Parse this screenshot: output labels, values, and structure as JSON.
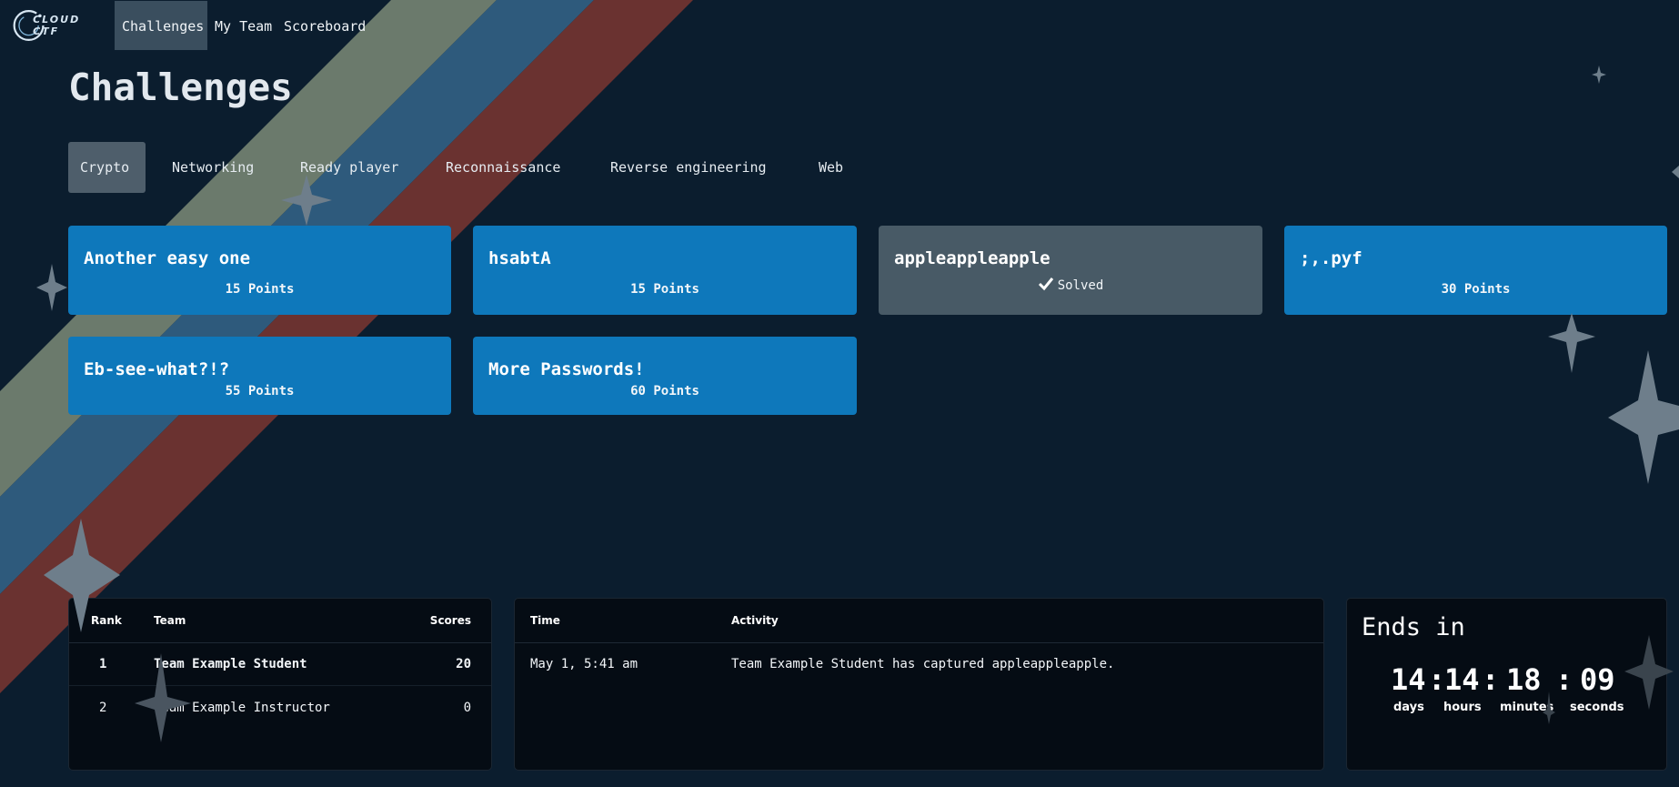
{
  "colors": {
    "background": "#0b1d2e",
    "stripe_sage": "#6b7a6c",
    "stripe_blue": "#2e5a7c",
    "stripe_red": "#6a3230",
    "card_blue": "#0e78bb",
    "card_solved": "#485a66",
    "nav_active": "#3a4e5e",
    "tab_active": "#4e5e6b",
    "panel_bg": "#050c14",
    "sparkle": "#6e7e8b"
  },
  "brand": {
    "name": "CLOUD CTF",
    "logo_icon": "cloud-ctf-logo-icon"
  },
  "nav": {
    "items": [
      {
        "label": "Challenges",
        "active": true
      },
      {
        "label": "My Team",
        "active": false
      },
      {
        "label": "Scoreboard",
        "active": false
      }
    ]
  },
  "page": {
    "title": "Challenges"
  },
  "tabs": [
    {
      "label": "Crypto",
      "active": true
    },
    {
      "label": "Networking",
      "active": false
    },
    {
      "label": "Ready player",
      "active": false
    },
    {
      "label": "Reconnaissance",
      "active": false
    },
    {
      "label": "Reverse engineering",
      "active": false
    },
    {
      "label": "Web",
      "active": false
    }
  ],
  "challenges": [
    {
      "title": "Another easy one",
      "points": "15 Points",
      "solved": false
    },
    {
      "title": "hsabtA",
      "points": "15 Points",
      "solved": false
    },
    {
      "title": "appleappleapple",
      "status": "Solved",
      "solved": true,
      "status_icon": "check-icon"
    },
    {
      "title": ";,.pyf",
      "points": "30 Points",
      "solved": false
    },
    {
      "title": "Eb-see-what?!?",
      "points": "55 Points",
      "solved": false
    },
    {
      "title": "More Passwords!",
      "points": "60 Points",
      "solved": false
    }
  ],
  "scoreboard": {
    "headers": {
      "rank": "Rank",
      "team": "Team",
      "scores": "Scores"
    },
    "rows": [
      {
        "rank": "1",
        "team": "Team Example Student",
        "score": "20"
      },
      {
        "rank": "2",
        "team": "Team Example Instructor",
        "score": "0"
      }
    ]
  },
  "activity": {
    "headers": {
      "time": "Time",
      "activity": "Activity"
    },
    "rows": [
      {
        "time": "May 1, 5:41 am",
        "text": "Team Example Student has captured appleappleapple."
      }
    ]
  },
  "timer": {
    "title": "Ends in",
    "days": "14",
    "hours": "14",
    "minutes": "18",
    "seconds": "09",
    "sep1": ":",
    "sep2": ":",
    "sep3": ":",
    "labels": {
      "days": "days",
      "hours": "hours",
      "minutes": "minutes",
      "seconds": "seconds"
    }
  }
}
